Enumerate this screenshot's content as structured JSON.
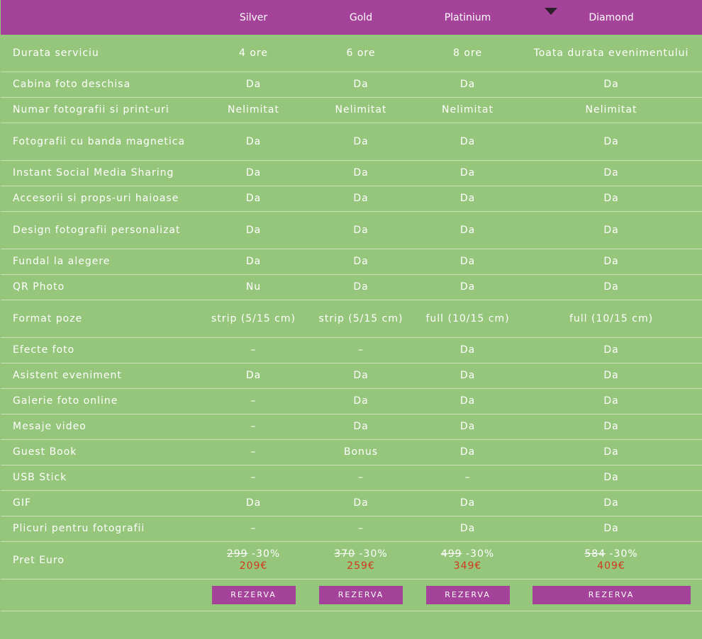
{
  "headers": [
    "Silver",
    "Gold",
    "Platinium",
    "Diamond"
  ],
  "rows": [
    {
      "label": "Durata serviciu",
      "cells": [
        "4 ore",
        "6 ore",
        "8 ore",
        "Toata durata evenimentului"
      ]
    },
    {
      "label": "Cabina foto deschisa",
      "cells": [
        "Da",
        "Da",
        "Da",
        "Da"
      ]
    },
    {
      "label": "Numar fotografii si print-uri",
      "cells": [
        "Nelimitat",
        "Nelimitat",
        "Nelimitat",
        "Nelimitat"
      ]
    },
    {
      "label": "Fotografii cu banda magnetica",
      "cells": [
        "Da",
        "Da",
        "Da",
        "Da"
      ]
    },
    {
      "label": "Instant Social Media Sharing",
      "cells": [
        "Da",
        "Da",
        "Da",
        "Da"
      ]
    },
    {
      "label": "Accesorii si props-uri haioase",
      "cells": [
        "Da",
        "Da",
        "Da",
        "Da"
      ]
    },
    {
      "label": "Design fotografii personalizat",
      "cells": [
        "Da",
        "Da",
        "Da",
        "Da"
      ]
    },
    {
      "label": "Fundal la alegere",
      "cells": [
        "Da",
        "Da",
        "Da",
        "Da"
      ]
    },
    {
      "label": "QR Photo",
      "cells": [
        "Nu",
        "Da",
        "Da",
        "Da"
      ]
    },
    {
      "label": "Format poze",
      "cells": [
        "strip (5/15 cm)",
        "strip (5/15 cm)",
        "full (10/15 cm)",
        "full (10/15 cm)"
      ]
    },
    {
      "label": "Efecte foto",
      "cells": [
        "–",
        "–",
        "Da",
        "Da"
      ]
    },
    {
      "label": "Asistent eveniment",
      "cells": [
        "Da",
        "Da",
        "Da",
        "Da"
      ]
    },
    {
      "label": "Galerie foto online",
      "cells": [
        "–",
        "Da",
        "Da",
        "Da"
      ]
    },
    {
      "label": "Mesaje video",
      "cells": [
        "–",
        "Da",
        "Da",
        "Da"
      ]
    },
    {
      "label": "Guest Book",
      "cells": [
        "–",
        "Bonus",
        "Da",
        "Da"
      ]
    },
    {
      "label": "USB Stick",
      "cells": [
        "–",
        "–",
        "–",
        "Da"
      ]
    },
    {
      "label": "GIF",
      "cells": [
        "Da",
        "Da",
        "Da",
        "Da"
      ]
    },
    {
      "label": "Plicuri pentru fotografii",
      "cells": [
        "–",
        "–",
        "Da",
        "Da"
      ]
    }
  ],
  "price": {
    "label": "Pret Euro",
    "discount": "-30%",
    "items": [
      {
        "old": "299",
        "new": "209€"
      },
      {
        "old": "370",
        "new": "259€"
      },
      {
        "old": "499",
        "new": "349€"
      },
      {
        "old": "584",
        "new": "409€"
      }
    ]
  },
  "reserve_label": "REZERVA",
  "colors": {
    "header_bg": "#a54299",
    "body_bg": "#95c67b",
    "price_new": "#d13a1e",
    "button_bg": "#a54299"
  }
}
